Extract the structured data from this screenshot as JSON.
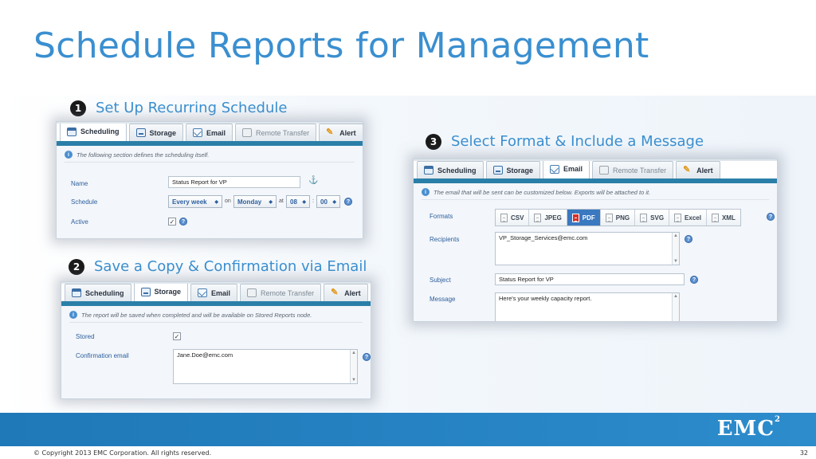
{
  "slide": {
    "title": "Schedule Reports for Management",
    "copyright": "© Copyright 2013 EMC Corporation. All rights reserved.",
    "page_number": "32",
    "logo": {
      "text": "EMC",
      "superscript": "2"
    },
    "accent_color": "#3a8fd0",
    "band_color": "#2585c4"
  },
  "steps": [
    {
      "number": "1",
      "label": "Set Up Recurring Schedule"
    },
    {
      "number": "2",
      "label": "Save a Copy & Confirmation via Email"
    },
    {
      "number": "3",
      "label": "Select Format & Include a Message"
    }
  ],
  "tabs": [
    {
      "label": "Scheduling",
      "icon": "calendar-icon"
    },
    {
      "label": "Storage",
      "icon": "disk-icon"
    },
    {
      "label": "Email",
      "icon": "envelope-icon"
    },
    {
      "label": "Remote Transfer",
      "icon": "remote-icon"
    },
    {
      "label": "Alert",
      "icon": "alert-icon"
    }
  ],
  "scheduling": {
    "info": "The following section defines the scheduling itself.",
    "name_label": "Name",
    "name_value": "Status Report for VP",
    "schedule_label": "Schedule",
    "frequency": "Every week",
    "on_text": "on",
    "day": "Monday",
    "at_text": "at",
    "hour": "08",
    "sep": ":",
    "minute": "00",
    "active_label": "Active",
    "active_checked": true,
    "check_mark": "✓"
  },
  "storage": {
    "info": "The report will be saved when completed and will be available on Stored Reports node.",
    "stored_label": "Stored",
    "stored_checked": true,
    "check_mark": "✓",
    "confirmation_label": "Confirmation email",
    "confirmation_value": "Jane.Doe@emc.com"
  },
  "email": {
    "info": "The email that will be sent can be customized below. Exports will be attached to it.",
    "formats_label": "Formats",
    "formats": [
      "CSV",
      "JPEG",
      "PDF",
      "PNG",
      "SVG",
      "Excel",
      "XML"
    ],
    "active_format": "PDF",
    "recipients_label": "Recipients",
    "recipients_value": "VP_Storage_Services@emc.com",
    "subject_label": "Subject",
    "subject_value": "Status Report for VP",
    "message_label": "Message",
    "message_value": "Here's your weekly capacity report."
  }
}
